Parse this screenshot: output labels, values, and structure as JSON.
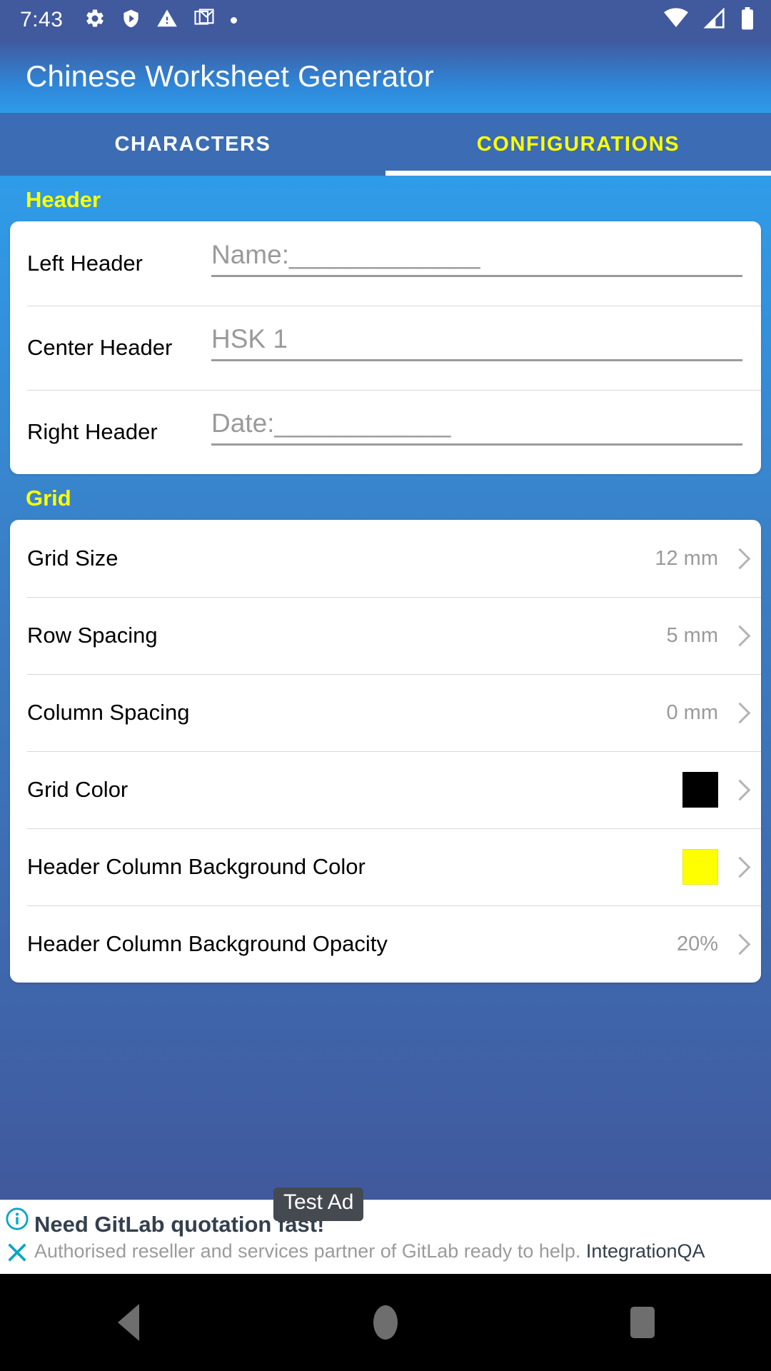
{
  "status_bar": {
    "time": "7:43",
    "left_icons": [
      "gear-icon",
      "play-protect-shield-icon",
      "warning-triangle-icon",
      "gmail-icon",
      "dot-icon"
    ],
    "right_icons": [
      "wifi-icon",
      "cellular-signal-icon",
      "battery-icon"
    ]
  },
  "app_bar": {
    "title": "Chinese Worksheet Generator"
  },
  "tabs": [
    {
      "label": "CHARACTERS",
      "active": false
    },
    {
      "label": "CONFIGURATIONS",
      "active": true
    }
  ],
  "sections": {
    "header": {
      "title": "Header",
      "fields": [
        {
          "label": "Left Header",
          "value": "Name:_____________"
        },
        {
          "label": "Center Header",
          "value": "HSK 1"
        },
        {
          "label": "Right Header",
          "value": "Date:____________"
        }
      ]
    },
    "grid": {
      "title": "Grid",
      "rows": [
        {
          "label": "Grid Size",
          "value": "12 mm",
          "type": "value"
        },
        {
          "label": "Row Spacing",
          "value": "5 mm",
          "type": "value"
        },
        {
          "label": "Column Spacing",
          "value": "0 mm",
          "type": "value"
        },
        {
          "label": "Grid Color",
          "value": "",
          "type": "color",
          "color": "#000000"
        },
        {
          "label": "Header Column Background Color",
          "value": "",
          "type": "color",
          "color": "#ffff00"
        },
        {
          "label": "Header Column Background Opacity",
          "value": "20%",
          "type": "value"
        }
      ]
    }
  },
  "ad": {
    "badge": "Test Ad",
    "title": "Need GitLab quotation fast!",
    "subtitle": "Authorised reseller and services partner of GitLab ready to help. ",
    "brand": "IntegrationQA"
  },
  "nav_bar": {
    "back": "back-button",
    "home": "home-button",
    "recents": "recents-button"
  },
  "colors": {
    "accent_yellow": "#ffff00",
    "status_bar": "#41599d",
    "tab_bar": "#3b6cb4",
    "body_top": "#2f9ce9",
    "body_bottom": "#41599d"
  }
}
